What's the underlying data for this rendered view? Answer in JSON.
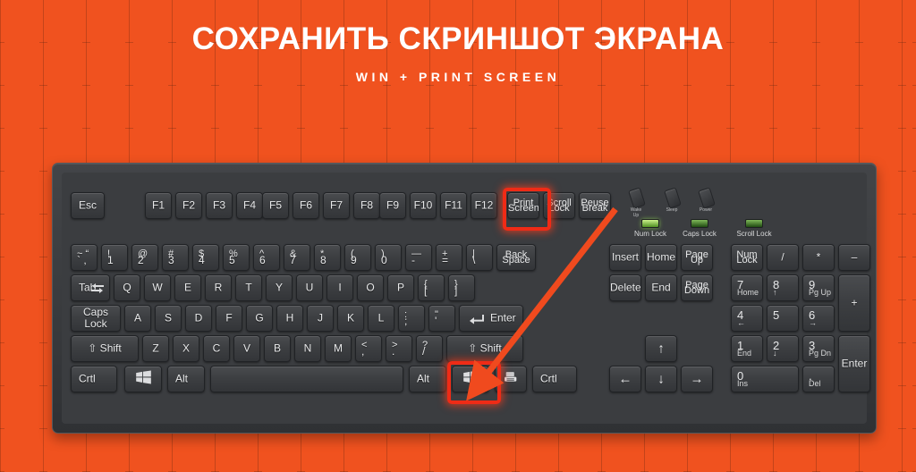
{
  "theme": {
    "background_color": "#f0521f",
    "title_color": "#ffffff",
    "highlight_color": "#ef2b16",
    "arrow_color": "#f04a1e",
    "key_color": "#3d3f42"
  },
  "header": {
    "title": "СОХРАНИТЬ СКРИНШОТ ЭКРАНА",
    "subtitle": "WIN + PRINT SCREEN"
  },
  "keyboard": {
    "function_row": {
      "esc": "Esc",
      "f_keys": [
        "F1",
        "F2",
        "F3",
        "F4",
        "F5",
        "F6",
        "F7",
        "F8",
        "F9",
        "F10",
        "F11",
        "F12"
      ],
      "print_screen": {
        "line1": "Print",
        "line2": "Screen"
      },
      "scroll_lock": {
        "line1": "Scroll",
        "line2": "Lock"
      },
      "pause_break": {
        "line1": "Peuse",
        "line2": "Break"
      }
    },
    "indicators": {
      "buttons": [
        {
          "label": "Wake\nUp"
        },
        {
          "label": "Sleep"
        },
        {
          "label": "Power"
        }
      ],
      "leds": [
        {
          "label": "Num Lock",
          "state": "on"
        },
        {
          "label": "Caps Lock",
          "state": "dim"
        },
        {
          "label": "Scroll Lock",
          "state": "dim"
        }
      ]
    },
    "number_row": [
      {
        "top": "~  “",
        "bottom": "`  ,"
      },
      {
        "top": "!",
        "bottom": "1"
      },
      {
        "top": "@",
        "bottom": "2"
      },
      {
        "top": "#",
        "bottom": "3"
      },
      {
        "top": "$",
        "bottom": "4"
      },
      {
        "top": "%",
        "bottom": "5"
      },
      {
        "top": "^",
        "bottom": "6"
      },
      {
        "top": "&",
        "bottom": "7"
      },
      {
        "top": "*",
        "bottom": "8"
      },
      {
        "top": "(",
        "bottom": "9"
      },
      {
        "top": ")",
        "bottom": "0"
      },
      {
        "top": "—",
        "bottom": "-"
      },
      {
        "top": "+",
        "bottom": "="
      },
      {
        "top": "|",
        "bottom": "\\"
      }
    ],
    "backspace": {
      "line1": "Back",
      "line2": "Space"
    },
    "qwerty_row": {
      "tab": "Tab",
      "keys": [
        "Q",
        "W",
        "E",
        "R",
        "T",
        "Y",
        "U",
        "I",
        "O",
        "P"
      ],
      "bracket_left": {
        "top": "{",
        "bottom": "["
      },
      "bracket_right": {
        "top": "}",
        "bottom": "]"
      }
    },
    "home_row": {
      "caps_lock": "Caps Lock",
      "keys": [
        "A",
        "S",
        "D",
        "F",
        "G",
        "H",
        "J",
        "K",
        "L"
      ],
      "semicolon": {
        "top": ":",
        "bottom": ";"
      },
      "quote": {
        "top": "\"",
        "bottom": "'"
      },
      "enter": "Enter"
    },
    "shift_row": {
      "shift_left": "Shift",
      "keys": [
        "Z",
        "X",
        "C",
        "V",
        "B",
        "N",
        "M"
      ],
      "comma": {
        "top": "<",
        "bottom": ","
      },
      "period": {
        "top": ">",
        "bottom": "."
      },
      "slash": {
        "top": "?",
        "bottom": "/"
      },
      "shift_right": "Shift"
    },
    "bottom_row": {
      "ctrl_left": "Crtl",
      "win_left": "win-logo-icon",
      "alt_left": "Alt",
      "space": "",
      "alt_right": "Alt",
      "win_right": "win-logo-icon",
      "menu": "menu-icon",
      "ctrl_right": "Crtl"
    },
    "nav_cluster": [
      {
        "label": "Insert"
      },
      {
        "label": "Home"
      },
      {
        "line1": "Page",
        "line2": "Up"
      },
      {
        "label": "Delete"
      },
      {
        "label": "End"
      },
      {
        "line1": "Page",
        "line2": "Down"
      }
    ],
    "arrows": {
      "up": "↑",
      "left": "←",
      "down": "↓",
      "right": "→"
    },
    "numpad": {
      "num_lock": {
        "line1": "Num",
        "line2": "Lock"
      },
      "divide": "/",
      "multiply": "*",
      "minus": "–",
      "plus": "+",
      "enter": "Enter",
      "keys": [
        {
          "num": "7",
          "sub": "Home"
        },
        {
          "num": "8",
          "sub": "↑"
        },
        {
          "num": "9",
          "sub": "Pg Up"
        },
        {
          "num": "4",
          "sub": "←"
        },
        {
          "num": "5",
          "sub": ""
        },
        {
          "num": "6",
          "sub": "→"
        },
        {
          "num": "1",
          "sub": "End"
        },
        {
          "num": "2",
          "sub": "↓"
        },
        {
          "num": "3",
          "sub": "Pg Dn"
        },
        {
          "num": "0",
          "sub": "Ins"
        },
        {
          "num": ".",
          "sub": "Del"
        }
      ]
    },
    "highlighted_keys": [
      "print-screen-key",
      "win-right-key"
    ]
  }
}
